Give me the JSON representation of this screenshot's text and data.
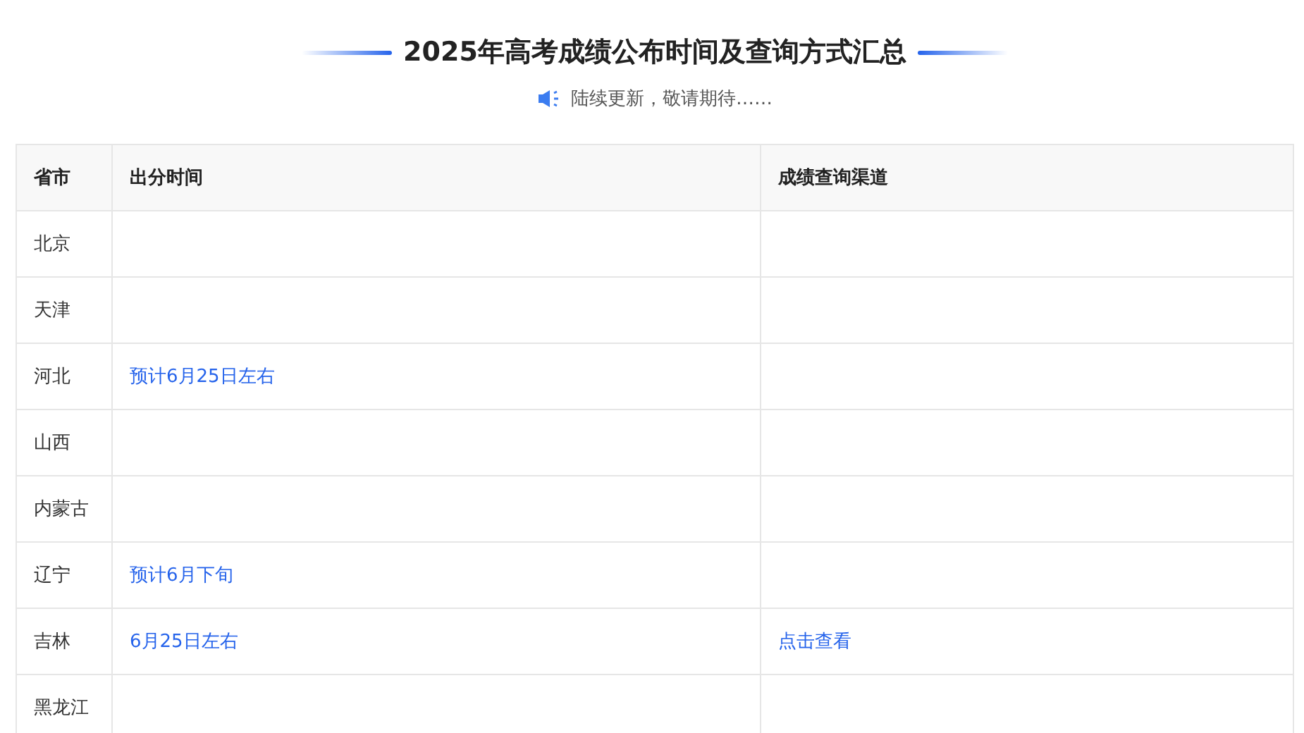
{
  "title": "2025年高考成绩公布时间及查询方式汇总",
  "notice": "陆续更新，敬请期待……",
  "table": {
    "columns": [
      "省市",
      "出分时间",
      "成绩查询渠道"
    ],
    "rows": [
      {
        "province": "北京"
      },
      {
        "province": "天津"
      },
      {
        "province": "河北",
        "release_time": "预计6月25日左右"
      },
      {
        "province": "山西"
      },
      {
        "province": "内蒙古"
      },
      {
        "province": "辽宁",
        "release_time": "预计6月下旬"
      },
      {
        "province": "吉林",
        "release_time": "6月25日左右",
        "query_channel": "点击查看"
      },
      {
        "province": "黑龙江"
      }
    ]
  }
}
